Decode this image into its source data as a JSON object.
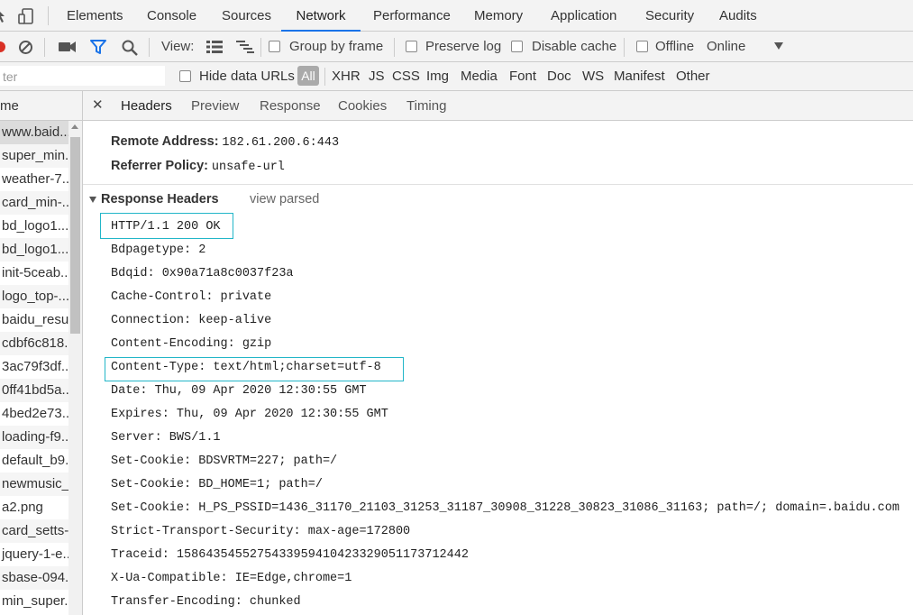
{
  "panel_tabs": [
    "Elements",
    "Console",
    "Sources",
    "Network",
    "Performance",
    "Memory",
    "Application",
    "Security",
    "Audits"
  ],
  "active_panel_tab": "Network",
  "toolbar": {
    "view_label": "View:",
    "group_by_frame": "Group by frame",
    "preserve_log": "Preserve log",
    "disable_cache": "Disable cache",
    "offline": "Offline",
    "online": "Online"
  },
  "filter": {
    "input_text": "ter",
    "hide_data_urls": "Hide data URLs",
    "types": [
      "All",
      "XHR",
      "JS",
      "CSS",
      "Img",
      "Media",
      "Font",
      "Doc",
      "WS",
      "Manifest",
      "Other"
    ]
  },
  "list": {
    "header": "me",
    "items": [
      "www.baid...",
      "super_min...",
      "weather-7...",
      "card_min-...",
      "bd_logo1...",
      "bd_logo1...",
      "init-5ceab...",
      "logo_top-...",
      "baidu_resu...",
      "cdbf6c818...",
      "3ac79f3df...",
      "0ff41bd5a...",
      "4bed2e73...",
      "loading-f9...",
      "default_b9...",
      "newmusic_...",
      "a2.png",
      "card_setts-...",
      "jquery-1-e...",
      "sbase-094...",
      "min_super..."
    ]
  },
  "detail_tabs": [
    "Headers",
    "Preview",
    "Response",
    "Cookies",
    "Timing"
  ],
  "general": {
    "remote_address_key": "Remote Address:",
    "remote_address_val": "182.61.200.6:443",
    "referrer_policy_key": "Referrer Policy:",
    "referrer_policy_val": "unsafe-url"
  },
  "response_headers": {
    "title": "Response Headers",
    "view_parsed": "view parsed",
    "lines": [
      "HTTP/1.1 200 OK",
      "Bdpagetype: 2",
      "Bdqid: 0x90a71a8c0037f23a",
      "Cache-Control: private",
      "Connection: keep-alive",
      "Content-Encoding: gzip",
      "Content-Type: text/html;charset=utf-8",
      "Date: Thu, 09 Apr 2020 12:30:55 GMT",
      "Expires: Thu, 09 Apr 2020 12:30:55 GMT",
      "Server: BWS/1.1",
      "Set-Cookie: BDSVRTM=227; path=/",
      "Set-Cookie: BD_HOME=1; path=/",
      "Set-Cookie: H_PS_PSSID=1436_31170_21103_31253_31187_30908_31228_30823_31086_31163; path=/; domain=.baidu.com",
      "Strict-Transport-Security: max-age=172800",
      "Traceid: 1586435455275433959410423329051173712442",
      "X-Ua-Compatible: IE=Edge,chrome=1",
      "Transfer-Encoding: chunked"
    ]
  },
  "colors": {
    "highlight": "#22b6c8",
    "active_tab_underline": "#1a73e8",
    "filter_icon": "#1a73e8"
  }
}
